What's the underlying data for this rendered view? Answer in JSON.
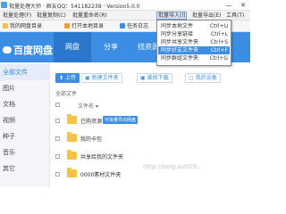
{
  "window": {
    "title": "批量处理大师 · 群友QQ：541182238 · Version5.0.0",
    "minimize": "—",
    "close": "✕"
  },
  "menubar": {
    "items": [
      {
        "label": "批量处理(F)"
      },
      {
        "label": "批量复制(C)"
      },
      {
        "label": "批量重命名(R)"
      },
      {
        "label": "批量导入(I)"
      },
      {
        "label": "批量导出(E)"
      },
      {
        "label": "工具(T)"
      }
    ],
    "active_index": 3
  },
  "dropdown": {
    "items": [
      {
        "label": "同步本地文件",
        "shortcut": "Ctrl+U"
      },
      {
        "label": "同步分享链接",
        "shortcut": "Ctrl+L"
      },
      {
        "label": "同步共享文件夹",
        "shortcut": "Ctrl+S"
      },
      {
        "label": "同步好友文件夹",
        "shortcut": "Ctrl+F"
      },
      {
        "label": "同步群组文件夹",
        "shortcut": "Ctrl+G"
      }
    ],
    "highlighted_index": 3
  },
  "toolbar": {
    "items": [
      {
        "label": "我的网盘目录"
      },
      {
        "label": "打开本地目录"
      },
      {
        "label": "任务日志"
      }
    ]
  },
  "header": {
    "logo": "百度网盘",
    "nav": [
      {
        "label": "网盘"
      },
      {
        "label": "分享"
      },
      {
        "label": "找资源"
      },
      {
        "label": "更多"
      }
    ],
    "active_nav": 0
  },
  "sidebar": {
    "items": [
      {
        "label": "全部文件"
      },
      {
        "label": "图片"
      },
      {
        "label": "文档"
      },
      {
        "label": "视频"
      },
      {
        "label": "种子"
      },
      {
        "label": "音乐"
      },
      {
        "label": "其它"
      }
    ],
    "active_index": 0
  },
  "actions": {
    "upload": "上传",
    "new_folder": "新建文件夹",
    "offline_download": "离线下载",
    "my_devices": "我的设备"
  },
  "content": {
    "breadcrumb": "全部文件",
    "column_name": "文件名",
    "rows": [
      {
        "name": "已购资源",
        "tag": "可批量导出网盘",
        "date": ""
      },
      {
        "name": "我的卡包",
        "tag": "",
        "date": "2019-05-20"
      },
      {
        "name": "共享给我的文件夹",
        "tag": "",
        "date": "2019-05-20"
      },
      {
        "name": "0000素材文件夹",
        "tag": "",
        "date": "2019-05-20"
      }
    ]
  },
  "watermark": "http://blog.az009..."
}
